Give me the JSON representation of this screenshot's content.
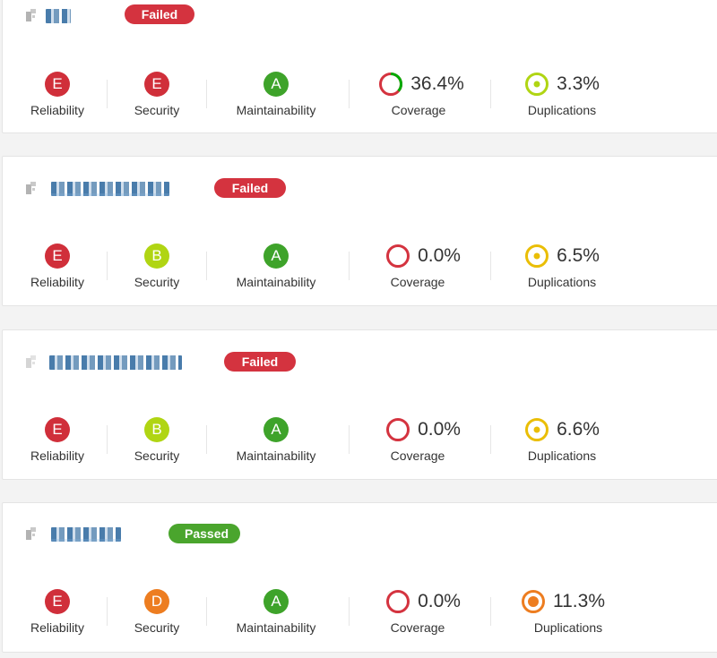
{
  "projects": [
    {
      "status": "Failed",
      "status_color": "#d4333f",
      "metrics": {
        "reliability": {
          "label": "Reliability",
          "rating": "E",
          "color": "#d02f3a"
        },
        "security": {
          "label": "Security",
          "rating": "E",
          "color": "#d02f3a"
        },
        "maintainability": {
          "label": "Maintainability",
          "rating": "A",
          "color": "#00aa00"
        },
        "coverage": {
          "label": "Coverage",
          "value": "36.4%",
          "fraction": 0.364
        },
        "duplications": {
          "label": "Duplications",
          "value": "3.3%",
          "level_color": "#b0d513"
        }
      }
    },
    {
      "status": "Failed",
      "status_color": "#d4333f",
      "metrics": {
        "reliability": {
          "label": "Reliability",
          "rating": "E",
          "color": "#d02f3a"
        },
        "security": {
          "label": "Security",
          "rating": "B",
          "color": "#b0d513"
        },
        "maintainability": {
          "label": "Maintainability",
          "rating": "A",
          "color": "#00aa00"
        },
        "coverage": {
          "label": "Coverage",
          "value": "0.0%",
          "fraction": 0.0
        },
        "duplications": {
          "label": "Duplications",
          "value": "6.5%",
          "level_color": "#eabe06"
        }
      }
    },
    {
      "status": "Failed",
      "status_color": "#d4333f",
      "metrics": {
        "reliability": {
          "label": "Reliability",
          "rating": "E",
          "color": "#d02f3a"
        },
        "security": {
          "label": "Security",
          "rating": "B",
          "color": "#b0d513"
        },
        "maintainability": {
          "label": "Maintainability",
          "rating": "A",
          "color": "#00aa00"
        },
        "coverage": {
          "label": "Coverage",
          "value": "0.0%",
          "fraction": 0.0
        },
        "duplications": {
          "label": "Duplications",
          "value": "6.6%",
          "level_color": "#eabe06"
        }
      }
    },
    {
      "status": "Passed",
      "status_color": "#4aa52d",
      "metrics": {
        "reliability": {
          "label": "Reliability",
          "rating": "E",
          "color": "#d02f3a"
        },
        "security": {
          "label": "Security",
          "rating": "D",
          "color": "#ed7d20"
        },
        "maintainability": {
          "label": "Maintainability",
          "rating": "A",
          "color": "#00aa00"
        },
        "coverage": {
          "label": "Coverage",
          "value": "0.0%",
          "fraction": 0.0
        },
        "duplications": {
          "label": "Duplications",
          "value": "11.3%",
          "level_color": "#ed7d20"
        }
      }
    }
  ],
  "colors": {
    "coverage_covered": "#00aa00",
    "coverage_uncovered": "#d4333f",
    "failed": "#d4333f",
    "passed": "#4aa52d"
  }
}
